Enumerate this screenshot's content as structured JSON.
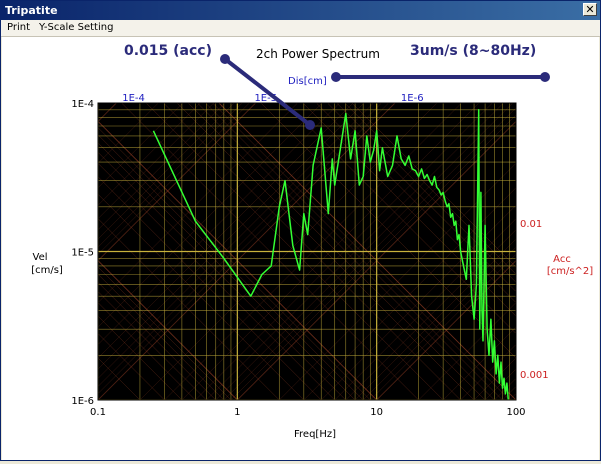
{
  "window": {
    "title": "Tripatite",
    "close_glyph": "✕"
  },
  "menu": {
    "items": [
      {
        "label": "Print"
      },
      {
        "label": "Y-Scale Setting"
      }
    ]
  },
  "annotations": {
    "left_text": "0.015 (acc)",
    "right_text": "3um/s (8~80Hz)",
    "color": "#2b2b7a"
  },
  "chart_data": {
    "type": "line",
    "title": "2ch Power Spectrum",
    "xlabel": "Freq[Hz]",
    "ylabel": "Vel\n[cm/s]",
    "ylabel_lines": [
      "Vel",
      "[cm/s]"
    ],
    "dis_label": "Dis[cm]",
    "acc_label_lines": [
      "Acc",
      "[cm/s^2]"
    ],
    "x_scale": "log",
    "y_scale": "log",
    "xlim": [
      0.1,
      100
    ],
    "ylim": [
      1e-06,
      0.0001
    ],
    "x_ticks": [
      {
        "value": 0.1,
        "label": "0.1"
      },
      {
        "value": 1,
        "label": "1"
      },
      {
        "value": 10,
        "label": "10"
      },
      {
        "value": 100,
        "label": "100"
      }
    ],
    "y_ticks": [
      {
        "value": 1e-06,
        "label": "1E-6"
      },
      {
        "value": 1e-05,
        "label": "1E-5"
      },
      {
        "value": 0.0001,
        "label": "1E-4"
      }
    ],
    "dis_ticks": [
      {
        "freq": 0.18,
        "label": "1E-4"
      },
      {
        "freq": 1.6,
        "label": "1E-5"
      },
      {
        "freq": 18,
        "label": "1E-6"
      }
    ],
    "acc_ticks": [
      {
        "vel": 1.55e-05,
        "label": "0.01"
      },
      {
        "vel": 1.5e-06,
        "label": "0.001"
      }
    ],
    "grid": true,
    "colors": {
      "background": "#000000",
      "grid": "#c8b23c",
      "diag": "#8a3a22",
      "line": "#33ff33",
      "dis_text": "#2020c0",
      "acc_text": "#cc2020"
    },
    "series": [
      {
        "x": [
          0.25,
          0.5,
          0.8,
          1.25,
          1.5,
          1.75,
          2.0,
          2.2,
          2.5,
          2.8,
          3.0,
          3.2,
          3.5,
          4.0,
          4.5,
          4.8,
          5.0,
          5.5,
          6.0,
          6.5,
          7.0,
          7.5,
          8.0,
          8.5,
          9.0,
          9.5,
          10.0,
          10.5,
          11.0,
          12.0,
          13.0,
          14.0,
          15.0,
          16.0,
          17.0,
          18.0,
          19.0,
          20.0,
          21.0,
          22.0,
          23.0,
          24.0,
          25.0,
          26.0,
          27.0,
          28.0,
          29.0,
          30.0,
          31.0,
          32.0,
          33.0,
          34.0,
          35.0,
          36.0,
          37.0,
          38.0,
          39.0,
          40.0,
          42.0,
          44.0,
          46.0,
          48.0,
          50.0,
          52.0,
          54.0,
          55.0,
          56.0,
          57.0,
          58.0,
          60.0,
          62.0,
          64.0,
          66.0,
          68.0,
          70.0,
          72.0,
          74.0,
          76.0,
          78.0,
          80.0,
          82.0,
          84.0,
          86.0,
          88.0
        ],
        "y": [
          6.5e-05,
          1.6e-05,
          9e-06,
          5e-06,
          7e-06,
          8e-06,
          2e-05,
          3e-05,
          1.1e-05,
          7.5e-06,
          1.8e-05,
          1.3e-05,
          3.8e-05,
          6.8e-05,
          1.8e-05,
          4.2e-05,
          2.8e-05,
          5e-05,
          8.5e-05,
          4.2e-05,
          6.5e-05,
          2.8e-05,
          3.2e-05,
          6e-05,
          4e-05,
          4.8e-05,
          6.5e-05,
          3.5e-05,
          5e-05,
          3.2e-05,
          3.8e-05,
          6e-05,
          4.2e-05,
          3.8e-05,
          4.4e-05,
          3.6e-05,
          3.5e-05,
          3.2e-05,
          3.6e-05,
          3.1e-05,
          3.3e-05,
          3e-05,
          2.8e-05,
          3.2e-05,
          2.7e-05,
          2.6e-05,
          2.4e-05,
          2.5e-05,
          2.2e-05,
          2e-05,
          2.1e-05,
          1.7e-05,
          1.8e-05,
          1.5e-05,
          1.6e-05,
          1.2e-05,
          1.3e-05,
          1e-05,
          8e-06,
          6.5e-06,
          1.5e-05,
          5e-06,
          3.5e-06,
          6e-06,
          9e-05,
          3e-06,
          2.5e-05,
          4e-06,
          2.5e-06,
          1.5e-05,
          3e-06,
          2e-06,
          3.5e-06,
          1.8e-06,
          2.5e-06,
          1.5e-06,
          2e-06,
          1.3e-06,
          1.8e-06,
          1.2e-06,
          1.4e-06,
          1.1e-06,
          1.3e-06,
          1e-06
        ]
      }
    ]
  }
}
